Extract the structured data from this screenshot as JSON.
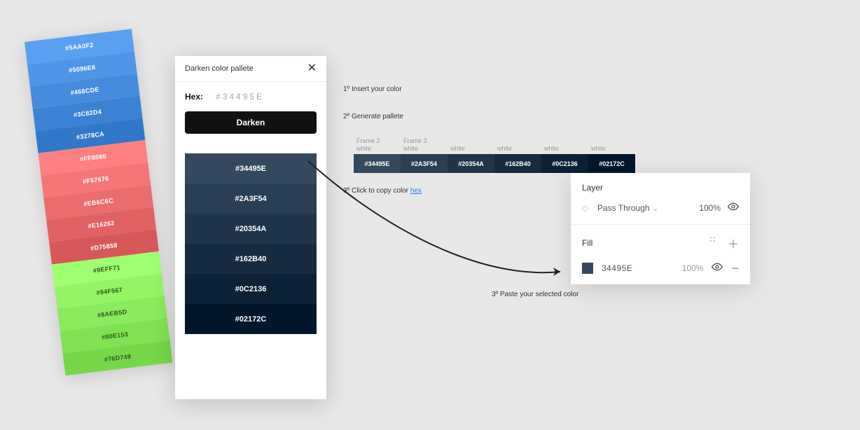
{
  "swatches": [
    {
      "hex": "#5AA0F2",
      "bg": "#5AA0F2"
    },
    {
      "hex": "#5096E8",
      "bg": "#5096E8"
    },
    {
      "hex": "#468CDE",
      "bg": "#468CDE"
    },
    {
      "hex": "#3C82D4",
      "bg": "#3C82D4"
    },
    {
      "hex": "#3278CA",
      "bg": "#3278CA"
    },
    {
      "hex": "#FF8080",
      "bg": "#FF8080"
    },
    {
      "hex": "#F57676",
      "bg": "#F57676"
    },
    {
      "hex": "#EB6C6C",
      "bg": "#EB6C6C"
    },
    {
      "hex": "#E16262",
      "bg": "#E16262"
    },
    {
      "hex": "#D75858",
      "bg": "#D75858"
    },
    {
      "hex": "#9EFF71",
      "bg": "#9EFF71"
    },
    {
      "hex": "#94F567",
      "bg": "#94F567"
    },
    {
      "hex": "#8AEB5D",
      "bg": "#8AEB5D"
    },
    {
      "hex": "#80E153",
      "bg": "#80E153"
    },
    {
      "hex": "#76D749",
      "bg": "#76D749"
    }
  ],
  "plugin": {
    "title": "Darken color pallete",
    "hex_label": "Hex:",
    "hex_value": "#34495E",
    "button": "Darken",
    "results": [
      {
        "hex": "#34495E",
        "bg": "#34495E"
      },
      {
        "hex": "#2A3F54",
        "bg": "#2A3F54"
      },
      {
        "hex": "#20354A",
        "bg": "#20354A"
      },
      {
        "hex": "#162B40",
        "bg": "#162B40"
      },
      {
        "hex": "#0C2136",
        "bg": "#0C2136"
      },
      {
        "hex": "#02172C",
        "bg": "#02172C"
      }
    ]
  },
  "steps": {
    "s1": "1º Insert your color",
    "s2": "2º Generate pallete",
    "s3_prefix": "3º Click to copy color ",
    "s3_link": "hex",
    "s4": "3º Paste your selected color"
  },
  "hstrip_labels": [
    {
      "line1": "Frame 2",
      "line2": "white"
    },
    {
      "line1": "Frame 3",
      "line2": "white"
    },
    {
      "line1": "",
      "line2": "white"
    },
    {
      "line1": "",
      "line2": "white"
    },
    {
      "line1": "",
      "line2": "white"
    },
    {
      "line1": "",
      "line2": "white"
    }
  ],
  "hstrip_cells": [
    {
      "hex": "#34495E"
    },
    {
      "hex": "#2A3F54"
    },
    {
      "hex": "#20354A"
    },
    {
      "hex": "#162B40"
    },
    {
      "hex": "#0C2136"
    },
    {
      "hex": "#02172C"
    }
  ],
  "layer_panel": {
    "layer_title": "Layer",
    "blend_mode": "Pass Through",
    "blend_pct": "100%",
    "fill_title": "Fill",
    "fill_hex": "34495E",
    "fill_bg": "#34495E",
    "fill_pct": "100%"
  }
}
